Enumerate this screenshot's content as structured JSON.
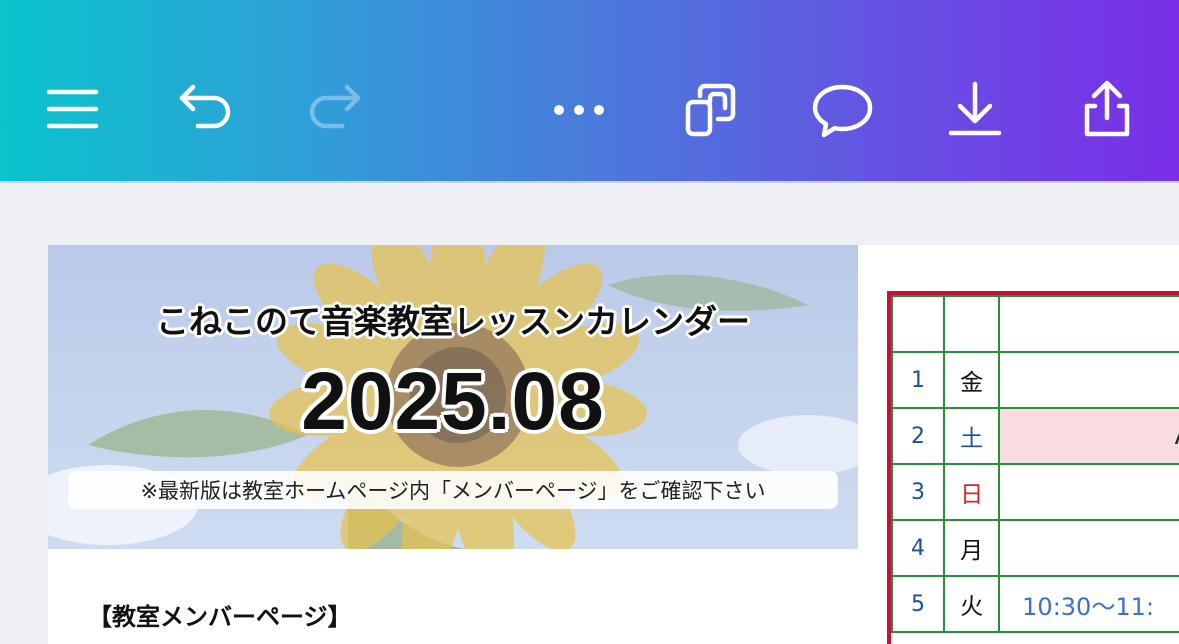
{
  "toolbar": {
    "gradient": [
      "#08c4cc",
      "#4f73dc",
      "#7a2fe6"
    ],
    "icons": [
      "menu-icon",
      "undo-icon",
      "redo-icon",
      "more-icon",
      "pages-icon",
      "comment-icon",
      "download-icon",
      "share-icon"
    ]
  },
  "banner": {
    "title": "こねこのて音楽教室レッスンカレンダー",
    "date": "2025.08",
    "note": "※最新版は教室ホームページ内「メンバーページ」をご確認下さい"
  },
  "section": {
    "heading": "【教室メンバーページ】"
  },
  "calendar": {
    "border_color": "#c8103c",
    "grid_color": "#2d8a3e",
    "rows": [
      {
        "day": "1",
        "dow": "金",
        "type": "weekday",
        "event": "",
        "highlight": false
      },
      {
        "day": "2",
        "dow": "土",
        "type": "sat",
        "event": "A",
        "highlight": true
      },
      {
        "day": "3",
        "dow": "日",
        "type": "sun",
        "event": "",
        "highlight": false
      },
      {
        "day": "4",
        "dow": "月",
        "type": "weekday",
        "event": "",
        "highlight": false
      },
      {
        "day": "5",
        "dow": "火",
        "type": "weekday",
        "event": "10:30〜11:",
        "highlight": false
      }
    ]
  }
}
